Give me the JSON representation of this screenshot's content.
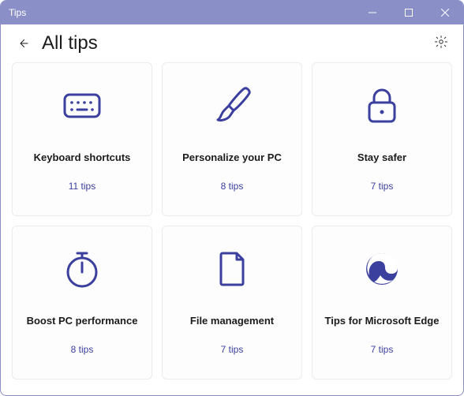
{
  "window": {
    "title": "Tips"
  },
  "header": {
    "title": "All tips"
  },
  "cards": [
    {
      "title": "Keyboard shortcuts",
      "count": "11 tips",
      "icon": "keyboard-icon"
    },
    {
      "title": "Personalize your PC",
      "count": "8 tips",
      "icon": "brush-icon"
    },
    {
      "title": "Stay safer",
      "count": "7 tips",
      "icon": "lock-icon"
    },
    {
      "title": "Boost PC performance",
      "count": "8 tips",
      "icon": "stopwatch-icon"
    },
    {
      "title": "File management",
      "count": "7 tips",
      "icon": "file-icon"
    },
    {
      "title": "Tips for Microsoft Edge",
      "count": "7 tips",
      "icon": "edge-icon"
    }
  ]
}
